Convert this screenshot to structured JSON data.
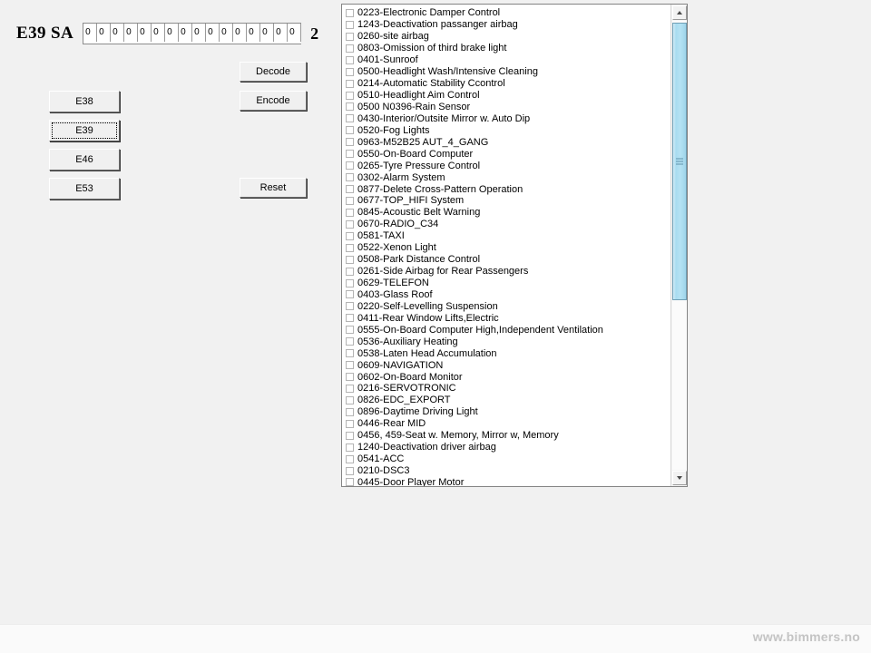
{
  "app": {
    "title": "E39 SA",
    "counter": "2"
  },
  "sa_code": {
    "fields": [
      "0",
      "0",
      "0",
      "0",
      "0",
      "0",
      "0",
      "0",
      "0",
      "0",
      "0",
      "0",
      "0",
      "0",
      "0",
      "0"
    ],
    "placeholder": "0"
  },
  "model_buttons": [
    {
      "label": "E38",
      "name": "model-button-e38",
      "focused": false
    },
    {
      "label": "E39",
      "name": "model-button-e39",
      "focused": true
    },
    {
      "label": "E46",
      "name": "model-button-e46",
      "focused": false
    },
    {
      "label": "E53",
      "name": "model-button-e53",
      "focused": false
    }
  ],
  "action_buttons": {
    "decode": "Decode",
    "encode": "Encode",
    "reset": "Reset"
  },
  "scrollbar": {
    "up_arrow_icon": "triangle-up-icon",
    "down_arrow_icon": "triangle-down-icon",
    "thumb_grip_icon": "grip-lines-icon",
    "thumb_color": "#a8dcf0"
  },
  "sa_list": {
    "items": [
      {
        "code": "0223",
        "label": "0223-Electronic Damper Control",
        "checked": false
      },
      {
        "code": "1243",
        "label": "1243-Deactivation passanger airbag",
        "checked": false
      },
      {
        "code": "0260",
        "label": "0260-site airbag",
        "checked": false
      },
      {
        "code": "0803",
        "label": "0803-Omission of third brake light",
        "checked": false
      },
      {
        "code": "0401",
        "label": "0401-Sunroof",
        "checked": false
      },
      {
        "code": "0500",
        "label": "0500-Headlight Wash/Intensive Cleaning",
        "checked": false
      },
      {
        "code": "0214",
        "label": "0214-Automatic Stability Ccontrol",
        "checked": false
      },
      {
        "code": "0510",
        "label": "0510-Headlight Aim Control",
        "checked": false
      },
      {
        "code": "0500",
        "label": "0500 N0396-Rain Sensor",
        "checked": false
      },
      {
        "code": "0430",
        "label": "0430-Interior/Outsite Mirror w. Auto Dip",
        "checked": false
      },
      {
        "code": "0520",
        "label": "0520-Fog Lights",
        "checked": false
      },
      {
        "code": "0963",
        "label": "0963-M52B25 AUT_4_GANG",
        "checked": false
      },
      {
        "code": "0550",
        "label": "0550-On-Board Computer",
        "checked": false
      },
      {
        "code": "0265",
        "label": "0265-Tyre Pressure Control",
        "checked": false
      },
      {
        "code": "0302",
        "label": "0302-Alarm System",
        "checked": false
      },
      {
        "code": "0877",
        "label": "0877-Delete Cross-Pattern Operation",
        "checked": false
      },
      {
        "code": "0677",
        "label": "0677-TOP_HIFI System",
        "checked": false
      },
      {
        "code": "0845",
        "label": "0845-Acoustic Belt Warning",
        "checked": false
      },
      {
        "code": "0670",
        "label": "0670-RADIO_C34",
        "checked": false
      },
      {
        "code": "0581",
        "label": "0581-TAXI",
        "checked": false
      },
      {
        "code": "0522",
        "label": "0522-Xenon Light",
        "checked": false
      },
      {
        "code": "0508",
        "label": "0508-Park Distance Control",
        "checked": false
      },
      {
        "code": "0261",
        "label": "0261-Side Airbag for Rear Passengers",
        "checked": false
      },
      {
        "code": "0629",
        "label": "0629-TELEFON",
        "checked": false
      },
      {
        "code": "0403",
        "label": "0403-Glass Roof",
        "checked": false
      },
      {
        "code": "0220",
        "label": "0220-Self-Levelling Suspension",
        "checked": false
      },
      {
        "code": "0411",
        "label": "0411-Rear Window Lifts,Electric",
        "checked": false
      },
      {
        "code": "0555",
        "label": "0555-On-Board Computer High,Independent Ventilation",
        "checked": false
      },
      {
        "code": "0536",
        "label": "0536-Auxiliary Heating",
        "checked": false
      },
      {
        "code": "0538",
        "label": "0538-Laten Head Accumulation",
        "checked": false
      },
      {
        "code": "0609",
        "label": "0609-NAVIGATION",
        "checked": false
      },
      {
        "code": "0602",
        "label": "0602-On-Board Monitor",
        "checked": false
      },
      {
        "code": "0216",
        "label": "0216-SERVOTRONIC",
        "checked": false
      },
      {
        "code": "0826",
        "label": "0826-EDC_EXPORT",
        "checked": false
      },
      {
        "code": "0896",
        "label": "0896-Daytime Driving Light",
        "checked": false
      },
      {
        "code": "0446",
        "label": "0446-Rear MID",
        "checked": false
      },
      {
        "code": "0456",
        "label": "0456, 459-Seat w. Memory, Mirror w, Memory",
        "checked": false
      },
      {
        "code": "1240",
        "label": "1240-Deactivation driver airbag",
        "checked": false
      },
      {
        "code": "0541",
        "label": "0541-ACC",
        "checked": false
      },
      {
        "code": "0210",
        "label": "0210-DSC3",
        "checked": false
      },
      {
        "code": "0445",
        "label": "0445-Door Player Motor",
        "checked": false
      }
    ]
  },
  "footer": {
    "watermark": "www.bimmers.no"
  }
}
